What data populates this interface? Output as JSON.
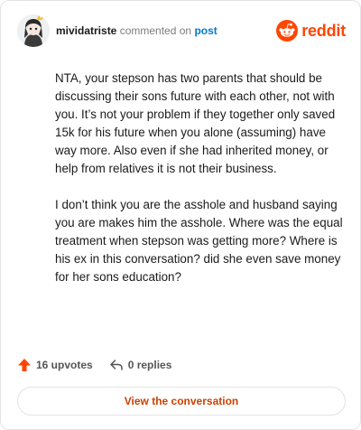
{
  "comment": {
    "username": "mividatriste",
    "action_text": "commented on",
    "target_label": "post",
    "paragraphs": [
      "NTA, your stepson has two parents that should be discussing their sons future with each other, not with you. It’s not your problem if they together only saved 15k for his future when you alone (assuming) have way more. Also even if she had inherited money, or help from relatives it is not their business.",
      "I don’t think you are the asshole and husband saying you are makes him the asshole. Where was the equal treatment when stepson was getting more? Where is his ex in this conversation? did she even save money for her sons education?"
    ]
  },
  "brand": {
    "wordmark": "reddit",
    "color": "#ff4500",
    "icon": "reddit-snoo-icon"
  },
  "footer": {
    "upvotes_label": "16 upvotes",
    "upvote_icon": "upvote-arrow-icon",
    "upvote_color": "#ff4500",
    "replies_label": "0 replies",
    "reply_icon": "reply-arrow-icon"
  },
  "cta": {
    "label": "View the conversation",
    "color": "#cc4100"
  },
  "avatar_icon": "user-avatar-icon"
}
